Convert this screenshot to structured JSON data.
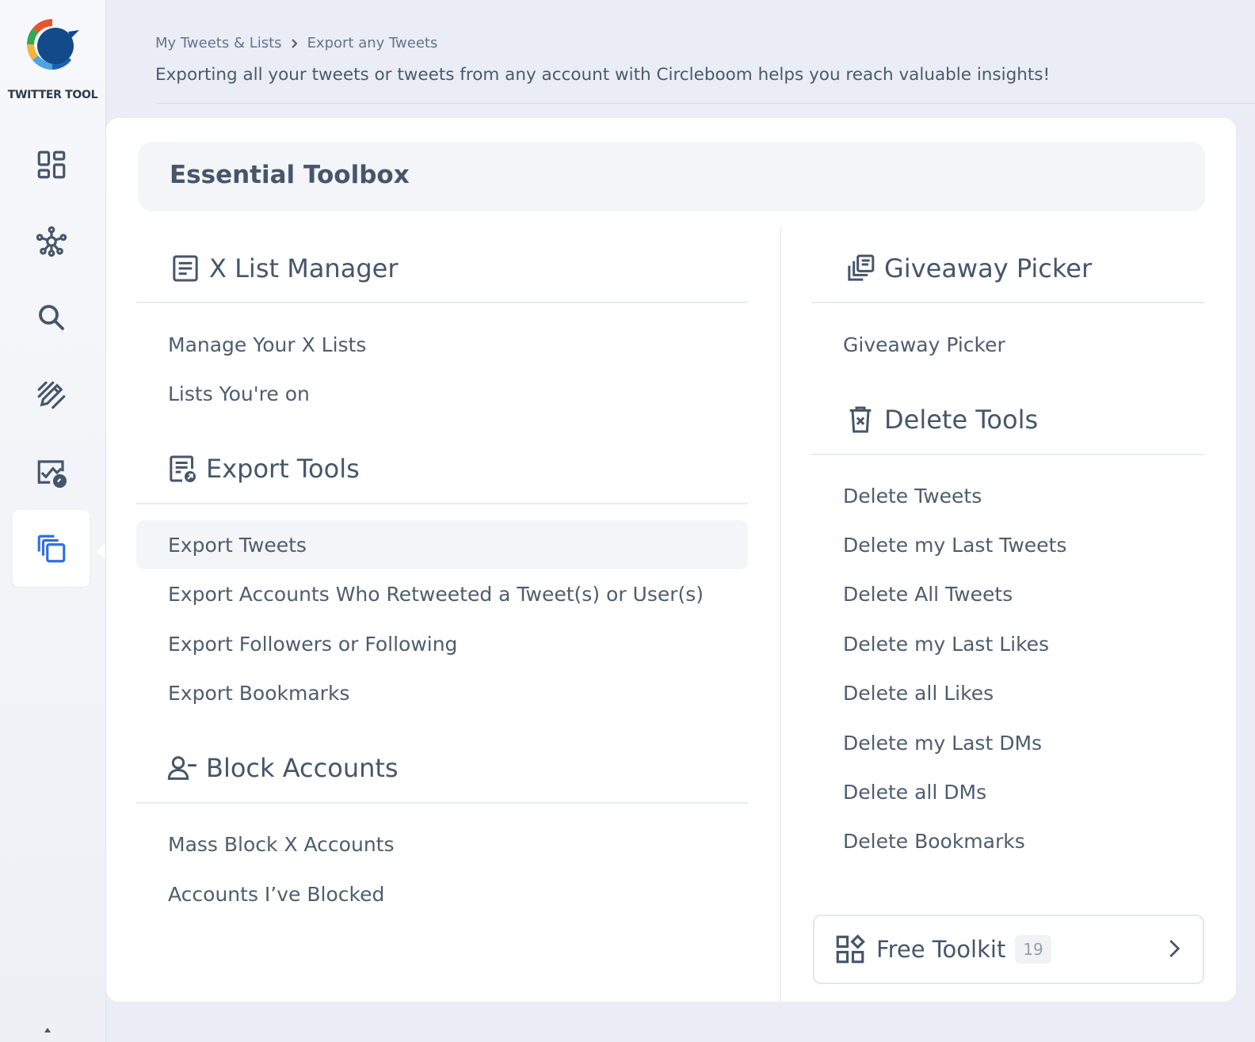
{
  "brand": {
    "logo_text": "TWITTER TOOL"
  },
  "sidebar": {
    "items": [
      {
        "icon": "dashboard-icon"
      },
      {
        "icon": "network-icon"
      },
      {
        "icon": "search-icon"
      },
      {
        "icon": "edit-icon"
      },
      {
        "icon": "analytics-icon"
      },
      {
        "icon": "tools-icon",
        "active": true
      }
    ]
  },
  "breadcrumb": {
    "items": [
      "My Tweets & Lists",
      "Export any Tweets"
    ]
  },
  "header": {
    "subtitle": "Exporting all your tweets or tweets from any account with Circleboom helps you reach valuable insights!"
  },
  "panel": {
    "title": "Essential Toolbox"
  },
  "left_column": {
    "list_manager": {
      "title": "X List Manager",
      "items": [
        "Manage Your X Lists",
        "Lists You're on"
      ]
    },
    "export_tools": {
      "title": "Export Tools",
      "items": [
        "Export Tweets",
        "Export Accounts Who Retweeted a Tweet(s) or User(s)",
        "Export Followers or Following",
        "Export Bookmarks"
      ],
      "highlighted": "Export Tweets"
    },
    "block_accounts": {
      "title": "Block Accounts",
      "items": [
        "Mass Block X Accounts",
        "Accounts I’ve Blocked"
      ]
    }
  },
  "right_column": {
    "giveaway": {
      "title": "Giveaway Picker",
      "items": [
        "Giveaway Picker"
      ]
    },
    "delete_tools": {
      "title": "Delete Tools",
      "items": [
        "Delete Tweets",
        "Delete my Last Tweets",
        "Delete All Tweets",
        "Delete my Last Likes",
        "Delete all Likes",
        "Delete my Last DMs",
        "Delete all DMs",
        "Delete Bookmarks"
      ]
    },
    "free_toolkit": {
      "label": "Free Toolkit",
      "count": "19"
    }
  },
  "colors": {
    "accent": "#2f6fe0",
    "icon": "#46566a",
    "background": "#eaedf5"
  }
}
